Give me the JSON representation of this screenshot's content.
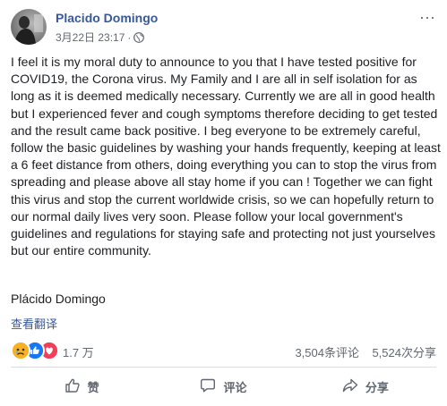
{
  "post": {
    "author": "Placido Domingo",
    "timestamp": "3月22日 23:17",
    "separator": "·",
    "text": "I feel it is my moral duty to announce to you that I have tested positive for COVID19, the Corona virus. My Family and I are all in self isolation for as long as it is deemed medically necessary. Currently we are all in good health but I experienced fever and cough symptoms therefore deciding to get tested and the result came back positive. I beg everyone to be extremely careful, follow the basic guidelines by washing your hands frequently, keeping at least a 6 feet distance from others, doing everything you can to stop the virus from spreading and please above all stay home if you can ! Together we can fight this virus and stop the current worldwide crisis, so we can hopefully return to our normal daily lives very soon. Please follow your local government's guidelines and regulations for staying safe and protecting not just yourselves but our entire community.",
    "signature": "Plácido Domingo",
    "translate_label": "查看翻译",
    "privacy_icon": "globe-icon",
    "more_icon": "more-options-icon"
  },
  "stats": {
    "reactions_count": "1.7 万",
    "reaction_icons": [
      "sad-reaction-icon",
      "like-reaction-icon",
      "love-reaction-icon"
    ],
    "comments": "3,504条评论",
    "shares": "5,524次分享"
  },
  "actions": {
    "like": "赞",
    "comment": "评论",
    "share": "分享"
  },
  "colors": {
    "link": "#385898",
    "meta": "#616770",
    "like_blue": "#1877f2",
    "love_red": "#f33e58",
    "sad_yellow": "#f7b125"
  }
}
